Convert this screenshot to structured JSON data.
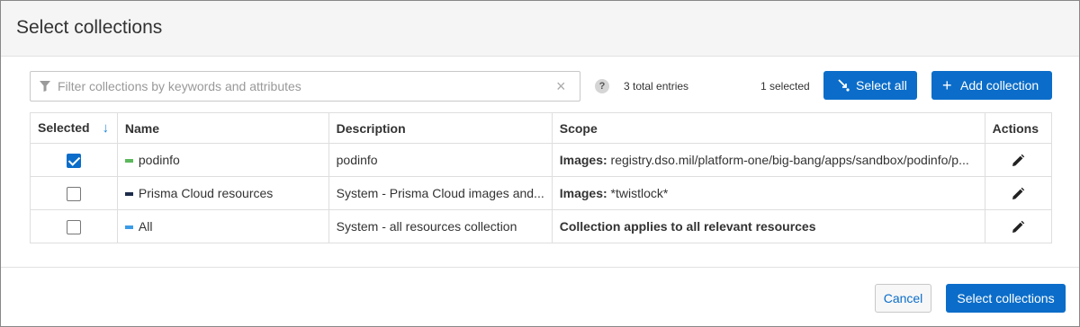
{
  "dialog": {
    "title": "Select collections"
  },
  "toolbar": {
    "filter_placeholder": "Filter collections by keywords and attributes",
    "filter_value": "",
    "clear_glyph": "×",
    "help_glyph": "?",
    "total_entries": "3 total entries",
    "selected_count": "1 selected",
    "select_all_label": "Select all",
    "add_collection_label": "Add collection",
    "add_glyph": "+"
  },
  "table": {
    "headers": {
      "selected": "Selected",
      "name": "Name",
      "description": "Description",
      "scope": "Scope",
      "actions": "Actions"
    },
    "sort_glyph": "↓",
    "rows": [
      {
        "checked": true,
        "name": "podinfo",
        "color": "#5cb85c",
        "description": "podinfo",
        "scope_label": "Images:",
        "scope_value": " registry.dso.mil/platform-one/big-bang/apps/sandbox/podinfo/p...",
        "scope_bold": false
      },
      {
        "checked": false,
        "name": "Prisma Cloud resources",
        "color": "#1c2b4a",
        "description": "System - Prisma Cloud images and...",
        "scope_label": "Images:",
        "scope_value": " *twistlock*",
        "scope_bold": false
      },
      {
        "checked": false,
        "name": "All",
        "color": "#3b9be6",
        "description": "System - all resources collection",
        "scope_label": "",
        "scope_value": "Collection applies to all relevant resources",
        "scope_bold": true
      }
    ]
  },
  "footer": {
    "cancel_label": "Cancel",
    "confirm_label": "Select collections"
  },
  "colors": {
    "primary": "#0b6dc9",
    "sort_arrow": "#1a85d6"
  },
  "icons": {
    "filter": "filter-icon",
    "clear": "close-icon",
    "help": "help-icon",
    "select_all": "select-cursor-icon",
    "add": "plus-icon",
    "edit": "pencil-icon",
    "sort": "arrow-down-icon"
  }
}
